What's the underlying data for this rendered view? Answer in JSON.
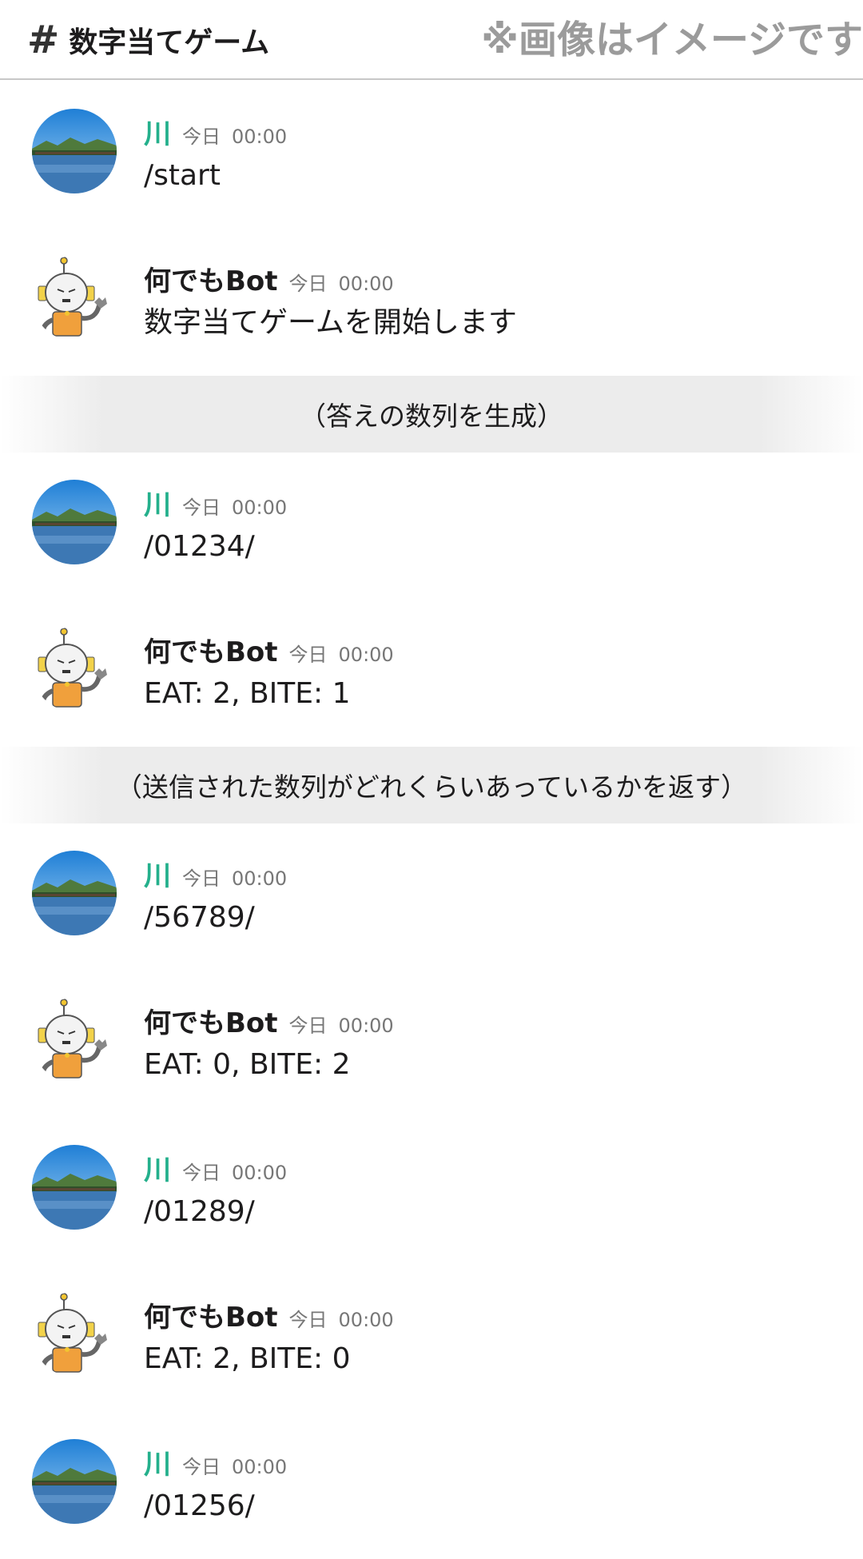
{
  "header": {
    "hash_symbol": "#",
    "channel_name": "数字当てゲーム",
    "note": "※画像はイメージです"
  },
  "users": {
    "river": {
      "name": "川",
      "color": "#24b08c",
      "avatar_icon": "river-landscape-icon"
    },
    "bot": {
      "name": "何でもBot",
      "color": "#1d1c1d",
      "avatar_icon": "robot-icon"
    }
  },
  "feed": [
    {
      "kind": "message",
      "user": "川",
      "day": "今日",
      "time": "00:00",
      "text": "/start"
    },
    {
      "kind": "message",
      "user": "何でもBot",
      "day": "今日",
      "time": "00:00",
      "text": "数字当てゲームを開始します"
    },
    {
      "kind": "annotation",
      "text": "（答えの数列を生成）"
    },
    {
      "kind": "message",
      "user": "川",
      "day": "今日",
      "time": "00:00",
      "text": "/01234/"
    },
    {
      "kind": "message",
      "user": "何でもBot",
      "day": "今日",
      "time": "00:00",
      "text": "EAT: 2, BITE: 1"
    },
    {
      "kind": "annotation",
      "text": "（送信された数列がどれくらいあっているかを返す）"
    },
    {
      "kind": "message",
      "user": "川",
      "day": "今日",
      "time": "00:00",
      "text": "/56789/"
    },
    {
      "kind": "message",
      "user": "何でもBot",
      "day": "今日",
      "time": "00:00",
      "text": "EAT: 0, BITE: 2"
    },
    {
      "kind": "message",
      "user": "川",
      "day": "今日",
      "time": "00:00",
      "text": "/01289/"
    },
    {
      "kind": "message",
      "user": "何でもBot",
      "day": "今日",
      "time": "00:00",
      "text": "EAT: 2, BITE: 0"
    },
    {
      "kind": "message",
      "user": "川",
      "day": "今日",
      "time": "00:00",
      "text": "/01256/"
    }
  ]
}
